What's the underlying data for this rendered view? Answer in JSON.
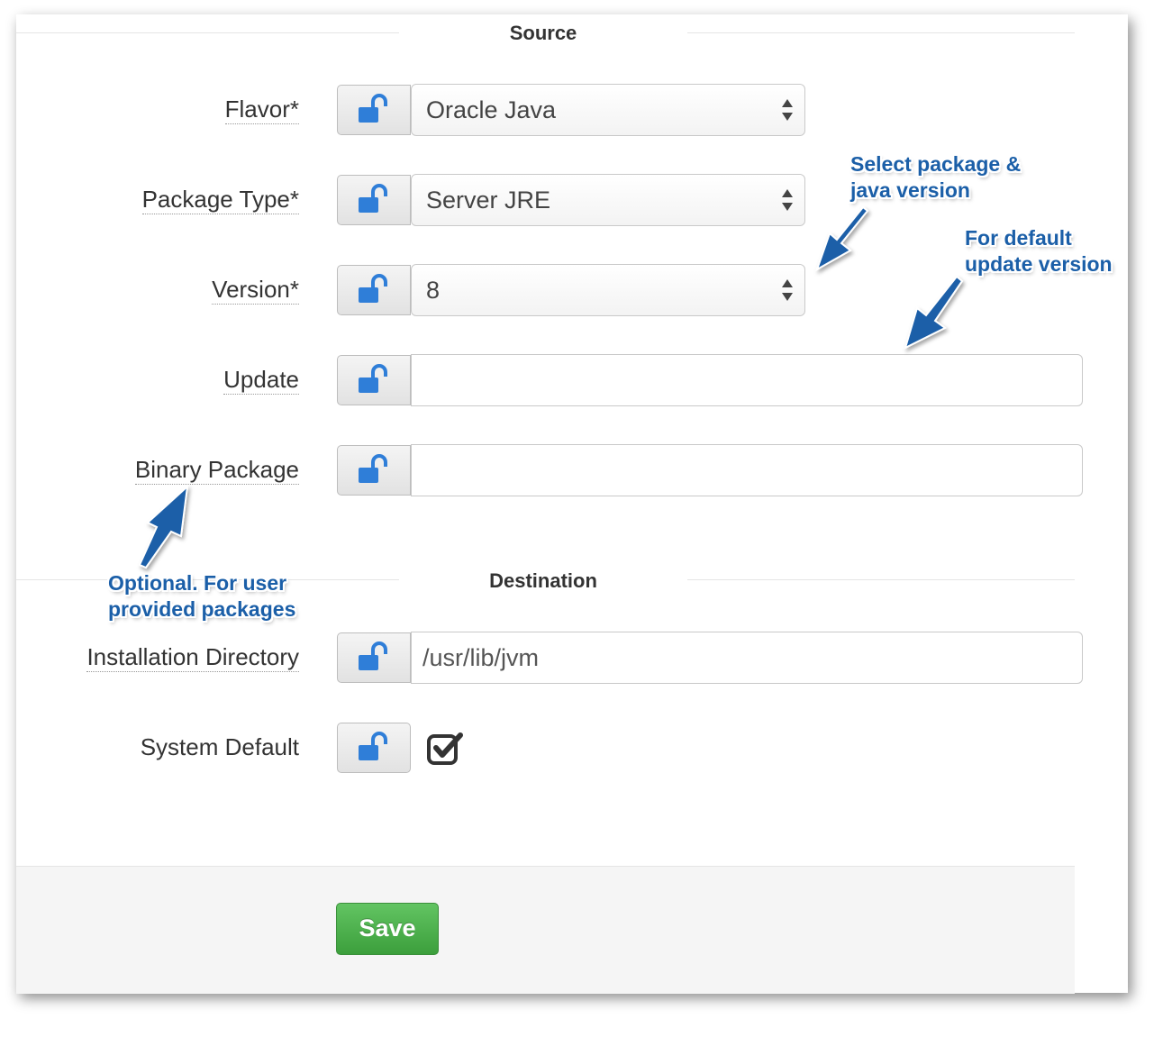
{
  "sections": {
    "source_title": "Source",
    "destination_title": "Destination"
  },
  "fields": {
    "flavor": {
      "label": "Flavor*",
      "value": "Oracle Java"
    },
    "package_type": {
      "label": "Package Type*",
      "value": "Server JRE"
    },
    "version": {
      "label": "Version*",
      "value": "8"
    },
    "update": {
      "label": "Update",
      "value": ""
    },
    "binary_package": {
      "label": "Binary Package",
      "value": ""
    },
    "installation_directory": {
      "label": "Installation Directory",
      "value": "/usr/lib/jvm"
    },
    "system_default": {
      "label": "System Default",
      "checked": true
    }
  },
  "footer": {
    "save_label": "Save"
  },
  "annotations": {
    "select_package": [
      "Select package &",
      "java version"
    ],
    "default_update": [
      "For  default",
      "update version"
    ],
    "optional": [
      "Optional. For user",
      "provided packages"
    ]
  },
  "colors": {
    "lock_icon": "#2f7ed8",
    "save_button": "#4cae4c",
    "annotation": "#1b5fa8"
  },
  "icons": {
    "lock": "unlock-icon",
    "select": "sort-caret-icon",
    "checkbox": "checked-square-icon"
  }
}
